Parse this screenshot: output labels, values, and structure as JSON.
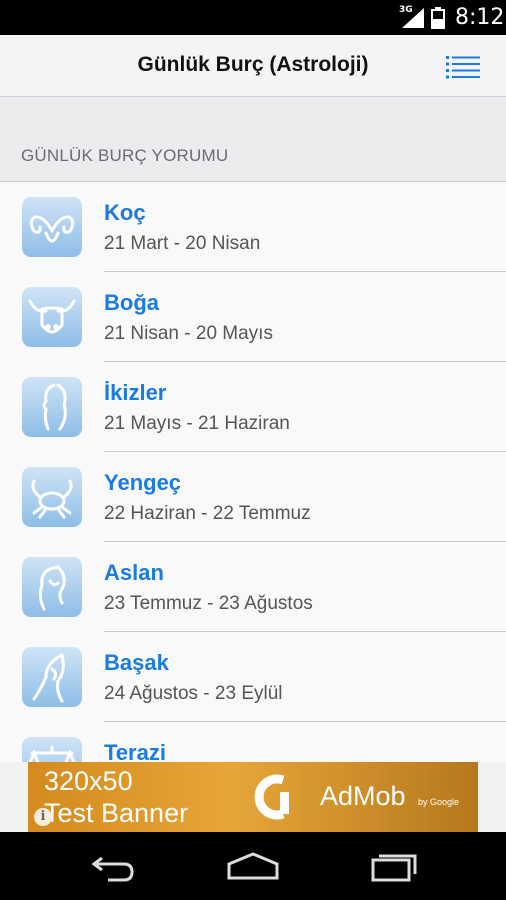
{
  "status_bar": {
    "network": "3G",
    "time": "8:12"
  },
  "app_bar": {
    "title": "Günlük Burç (Astroloji)",
    "menu_icon": "list-menu-icon"
  },
  "section_title": "GÜNLÜK BURÇ YORUMU",
  "signs": [
    {
      "name": "Koç",
      "dates": "21 Mart - 20 Nisan",
      "icon": "aries-icon"
    },
    {
      "name": "Boğa",
      "dates": "21 Nisan - 20 Mayıs",
      "icon": "taurus-icon"
    },
    {
      "name": "İkizler",
      "dates": "21 Mayıs - 21 Haziran",
      "icon": "gemini-icon"
    },
    {
      "name": "Yengeç",
      "dates": "22 Haziran - 22 Temmuz",
      "icon": "cancer-icon"
    },
    {
      "name": "Aslan",
      "dates": "23 Temmuz - 23 Ağustos",
      "icon": "leo-icon"
    },
    {
      "name": "Başak",
      "dates": "24 Ağustos - 23 Eylül",
      "icon": "virgo-icon"
    },
    {
      "name": "Terazi",
      "dates": "",
      "icon": "libra-icon"
    }
  ],
  "ad": {
    "line1": "320x50",
    "line2": "Test Banner",
    "brand": "AdMob",
    "by": "by Google",
    "info": "i"
  },
  "colors": {
    "accent": "#1a7be0",
    "icon_top": "#cfe4f6",
    "icon_bottom": "#8ebde6",
    "appbar": "#f4f4f6"
  }
}
